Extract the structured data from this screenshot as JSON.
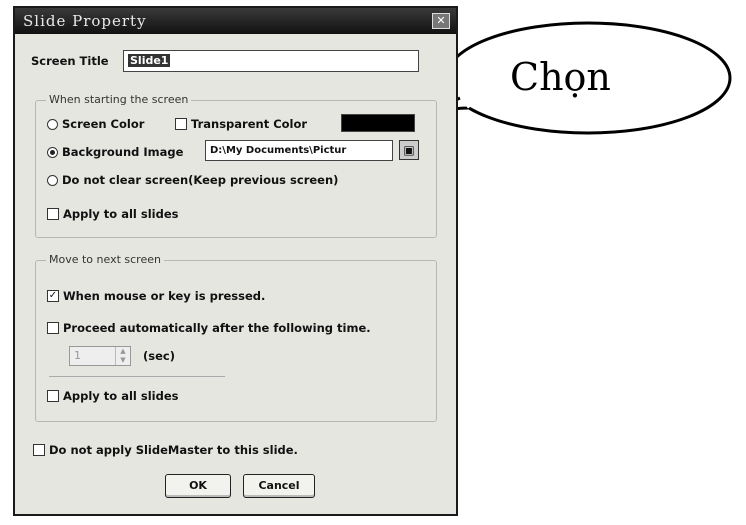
{
  "dialog": {
    "title": "Slide Property",
    "close_glyph": "✕"
  },
  "screen_title": {
    "label": "Screen Title",
    "value": "Slide1"
  },
  "starting": {
    "legend": "When starting the screen",
    "screen_color": "Screen Color",
    "transparent_color": "Transparent Color",
    "swatch_color": "#000000",
    "background_image": "Background Image",
    "background_path": "D:\\My Documents\\Pictur",
    "do_not_clear": "Do not clear screen(Keep previous screen)",
    "apply_all": "Apply to all slides",
    "selected_option": "background_image"
  },
  "next_screen": {
    "legend": "Move to next screen",
    "mouse_or_key": "When mouse or key is pressed.",
    "mouse_or_key_checked": true,
    "auto_proceed": "Proceed automatically after the following time.",
    "auto_proceed_checked": false,
    "time_value": "1",
    "time_unit": "(sec)",
    "apply_all": "Apply to all slides"
  },
  "master": {
    "label": "Do not apply SlideMaster to this slide."
  },
  "buttons": {
    "ok": "OK",
    "cancel": "Cancel"
  },
  "callout": {
    "text": "Chọn"
  }
}
